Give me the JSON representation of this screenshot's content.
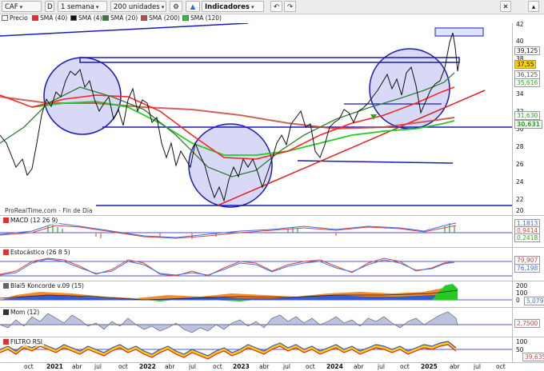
{
  "toolbar": {
    "symbol": "CAF",
    "period_letter": "D",
    "timeframe": "1 semana",
    "units": "200 unidades",
    "indicators_label": "Indicadores"
  },
  "legend": {
    "price": "Precio",
    "sma40": "SMA (40)",
    "sma4": "SMA (4)",
    "sma20": "SMA (20)",
    "sma200": "SMA (200)",
    "sma120": "SMA (120)"
  },
  "colors": {
    "sma40": "#ff2020",
    "sma4": "#111111",
    "sma20": "#2e7d32",
    "sma200": "#c8463c",
    "sma120": "#22cc22",
    "support": "#1a1ab8",
    "circle_fill": "#b8b8f0",
    "trend": "#e02020"
  },
  "main": {
    "source_label": "ProRealTime.com - Fin de Día",
    "axis_ticks": [
      "42",
      "40",
      "38",
      "36",
      "34",
      "32",
      "30",
      "28",
      "26",
      "24",
      "22",
      "20"
    ],
    "price_badges": [
      "39,125",
      "37,55",
      "36,125",
      "35,616",
      "31,630",
      "30,631"
    ]
  },
  "macd": {
    "label": "MACD (12 26 9)",
    "badges": [
      "1,1813",
      "0,9414",
      "0,2418"
    ]
  },
  "stoch": {
    "label": "Estocástico (26 8 5)",
    "badges": [
      "79,907",
      "76,198"
    ]
  },
  "blai5": {
    "label": "Blai5 Koncorde v.09 (15)",
    "axis_ticks": [
      "200",
      "100",
      "0"
    ],
    "badges": [
      "5,0798"
    ]
  },
  "mom": {
    "label": "Mom (12)",
    "badges": [
      "2,7500"
    ]
  },
  "rsi": {
    "label": "FILTRO RSI",
    "axis_ticks": [
      "100",
      "50"
    ],
    "badges": [
      "39,635"
    ]
  },
  "x_axis": [
    "oct",
    "2021",
    "abr",
    "jul",
    "oct",
    "2022",
    "abr",
    "jul",
    "oct",
    "2023",
    "abr",
    "jul",
    "oct",
    "2024",
    "abr",
    "jul",
    "oct",
    "2025",
    "abr",
    "jul",
    "oct"
  ]
}
